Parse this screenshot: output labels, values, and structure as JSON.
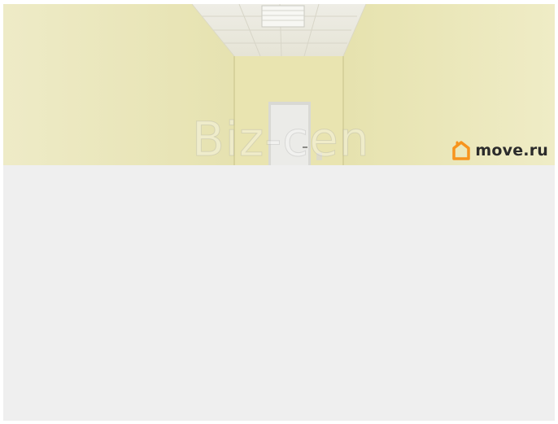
{
  "photo": {
    "watermark": "Biz-cen"
  },
  "brand": {
    "name": "move.ru",
    "icon": "house-logo-icon",
    "color": "#f7941d"
  },
  "colors": {
    "wall": "#ece9b9",
    "ceiling": "#ecebe2",
    "panel_background": "#efefef"
  }
}
